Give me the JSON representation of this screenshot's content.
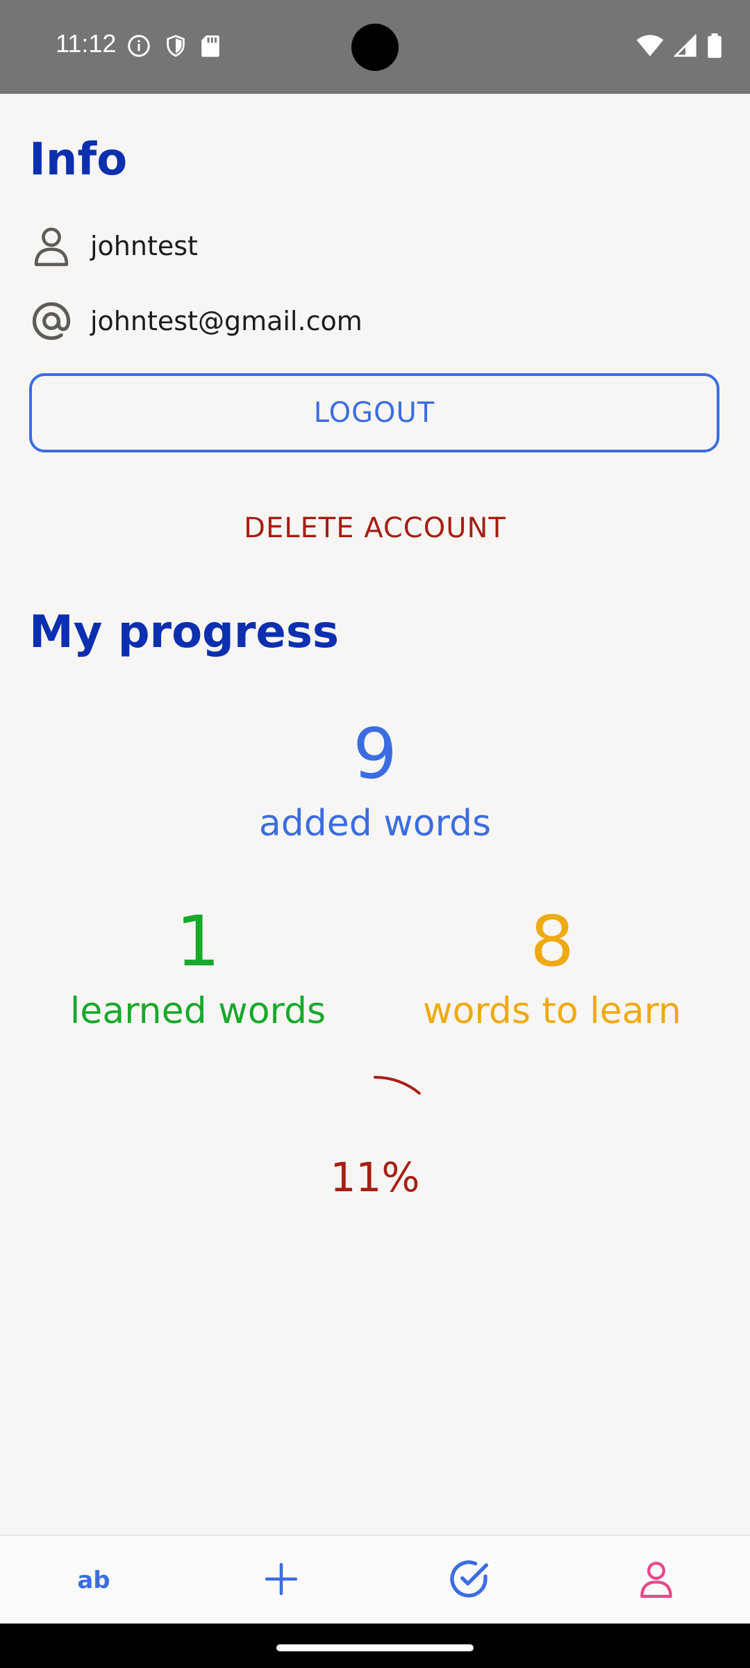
{
  "status_bar": {
    "time": "11:12"
  },
  "info": {
    "title": "Info",
    "username": "johntest",
    "email": "johntest@gmail.com",
    "logout_label": "LOGOUT",
    "delete_label": "DELETE ACCOUNT"
  },
  "progress": {
    "title": "My progress",
    "added": {
      "value": "9",
      "label": "added words"
    },
    "learned": {
      "value": "1",
      "label": "learned words"
    },
    "to_learn": {
      "value": "8",
      "label": "words to learn"
    },
    "percent_label": "11%",
    "percent_value": 11
  },
  "bottom_nav": {
    "items": [
      {
        "icon": "ab-icon",
        "label": "ab"
      },
      {
        "icon": "plus-icon"
      },
      {
        "icon": "check-circle-icon"
      },
      {
        "icon": "person-icon"
      }
    ],
    "active_index": 3
  },
  "colors": {
    "heading": "#0b2fae",
    "accent_blue": "#3b6de0",
    "danger": "#a51f12",
    "green": "#19a82c",
    "amber": "#eeaa11",
    "active_pink": "#e8488a"
  }
}
